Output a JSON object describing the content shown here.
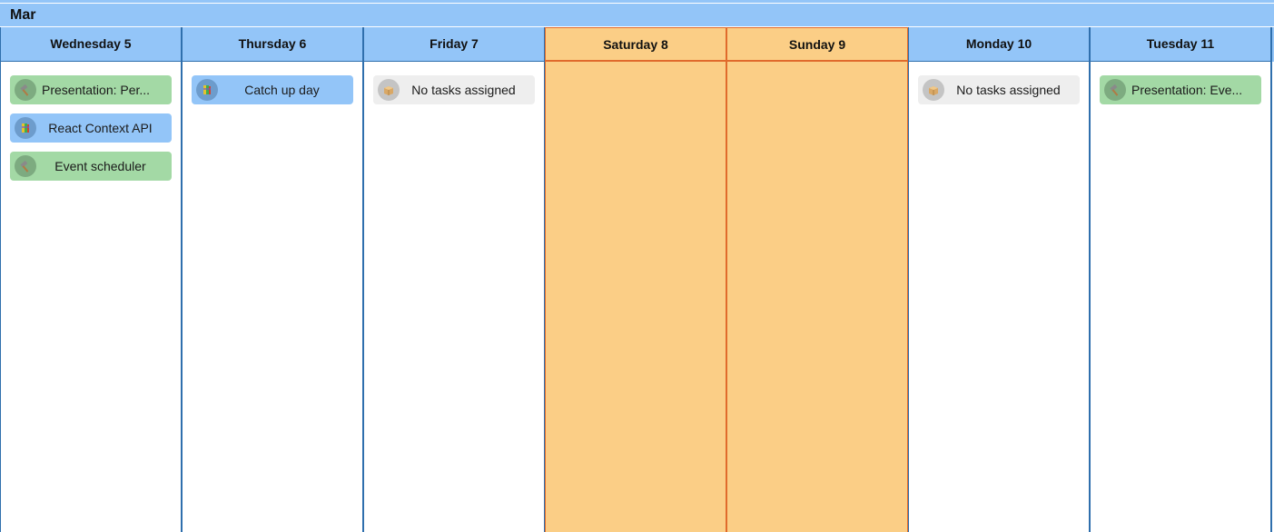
{
  "month": {
    "label": "Mar"
  },
  "days": [
    {
      "header": "Wednesday 5",
      "weekend": false,
      "tasks": [
        {
          "label": "Presentation: Per...",
          "color": "green",
          "icon": "hammer-icon"
        },
        {
          "label": "React Context API",
          "color": "blue",
          "icon": "book-icon"
        },
        {
          "label": "Event scheduler",
          "color": "green",
          "icon": "hammer-icon"
        }
      ]
    },
    {
      "header": "Thursday 6",
      "weekend": false,
      "tasks": [
        {
          "label": "Catch up day",
          "color": "blue",
          "icon": "book-icon"
        }
      ]
    },
    {
      "header": "Friday 7",
      "weekend": false,
      "tasks": [
        {
          "label": "No tasks assigned",
          "color": "gray",
          "icon": "box-icon"
        }
      ]
    },
    {
      "header": "Saturday 8",
      "weekend": true,
      "tasks": []
    },
    {
      "header": "Sunday 9",
      "weekend": true,
      "tasks": []
    },
    {
      "header": "Monday 10",
      "weekend": false,
      "tasks": [
        {
          "label": "No tasks assigned",
          "color": "gray",
          "icon": "box-icon"
        }
      ]
    },
    {
      "header": "Tuesday 11",
      "weekend": false,
      "tasks": [
        {
          "label": "Presentation: Eve...",
          "color": "green",
          "icon": "hammer-icon"
        }
      ]
    }
  ],
  "colors": {
    "header_blue": "#93c5f8",
    "weekend_orange": "#fbce86",
    "weekend_border": "#e06a2c",
    "column_border": "#2f6fad",
    "task_green": "#a3d9a5",
    "task_blue": "#93c5f8",
    "task_gray": "#eeeeee"
  }
}
